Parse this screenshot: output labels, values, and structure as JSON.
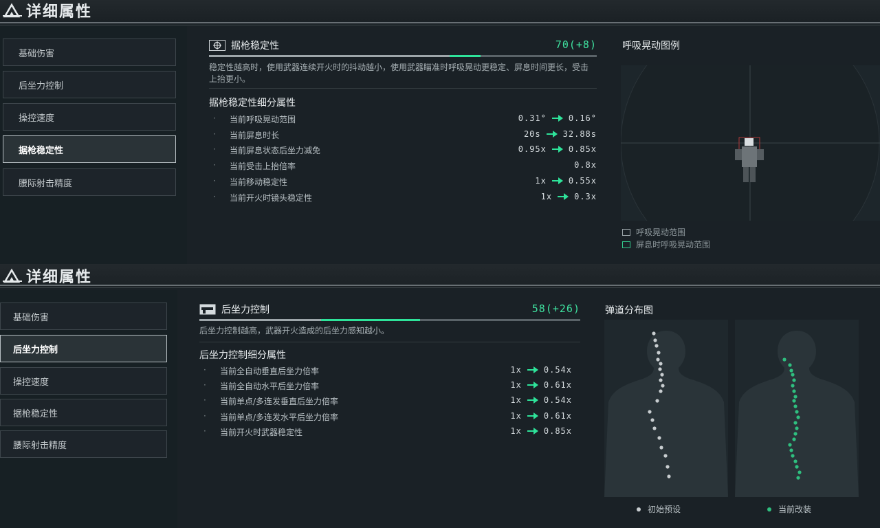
{
  "colors": {
    "accent_green": "#2ee39a",
    "text_primary": "#e6eaec",
    "panel_bg": "#1a2126",
    "grey_dot": "#c8cdd0",
    "green_dot": "#2fbf7f"
  },
  "panel_top": {
    "title": "详细属性",
    "logo_icon": "triangle-logo-icon",
    "nav": [
      {
        "label": "基础伤害",
        "active": false
      },
      {
        "label": "后坐力控制",
        "active": false
      },
      {
        "label": "操控速度",
        "active": false
      },
      {
        "label": "据枪稳定性",
        "active": true
      },
      {
        "label": "腰际射击精度",
        "active": false
      }
    ],
    "stat": {
      "icon": "crosshair-icon",
      "name": "据枪稳定性",
      "value": "70(+8)",
      "base_fraction": 0.62,
      "bonus_fraction": 0.08
    },
    "description": "稳定性越高时，使用武器连续开火时的抖动越小，使用武器瞄准时呼吸晃动更稳定、屏息时间更长，受击上抬更小。",
    "sub_title": "据枪稳定性细分属性",
    "rows": [
      {
        "label": "当前呼吸晃动范围",
        "from": "0.31°",
        "to": "0.16°"
      },
      {
        "label": "当前屏息时长",
        "from": "20s",
        "to": "32.88s"
      },
      {
        "label": "当前屏息状态后坐力减免",
        "from": "0.95x",
        "to": "0.85x"
      },
      {
        "label": "当前受击上抬倍率",
        "from": "",
        "to": "0.8x"
      },
      {
        "label": "当前移动稳定性",
        "from": "1x",
        "to": "0.55x"
      },
      {
        "label": "当前开火时镜头稳定性",
        "from": "1x",
        "to": "0.3x"
      }
    ],
    "side_title": "呼吸晃动图例",
    "legend": [
      {
        "label": "呼吸晃动范围"
      },
      {
        "label": "屏息时呼吸晃动范围"
      }
    ]
  },
  "panel_bottom": {
    "title": "详细属性",
    "logo_icon": "triangle-logo-icon",
    "nav": [
      {
        "label": "基础伤害",
        "active": false
      },
      {
        "label": "后坐力控制",
        "active": true
      },
      {
        "label": "操控速度",
        "active": false
      },
      {
        "label": "据枪稳定性",
        "active": false
      },
      {
        "label": "腰际射击精度",
        "active": false
      }
    ],
    "stat": {
      "icon": "gun-icon",
      "name": "后坐力控制",
      "value": "58(+26)",
      "base_fraction": 0.32,
      "bonus_fraction": 0.26
    },
    "description": "后坐力控制越高，武器开火造成的后坐力感知越小。",
    "sub_title": "后坐力控制细分属性",
    "rows": [
      {
        "label": "当前全自动垂直后坐力倍率",
        "from": "1x",
        "to": "0.54x"
      },
      {
        "label": "当前全自动水平后坐力倍率",
        "from": "1x",
        "to": "0.61x"
      },
      {
        "label": "当前单点/多连发垂直后坐力倍率",
        "from": "1x",
        "to": "0.54x"
      },
      {
        "label": "当前单点/多连发水平后坐力倍率",
        "from": "1x",
        "to": "0.61x"
      },
      {
        "label": "当前开火时武器稳定性",
        "from": "1x",
        "to": "0.85x"
      }
    ],
    "side_title": "弹道分布图",
    "dot_legend": [
      {
        "label": "初始预设"
      },
      {
        "label": "当前改装"
      }
    ]
  }
}
